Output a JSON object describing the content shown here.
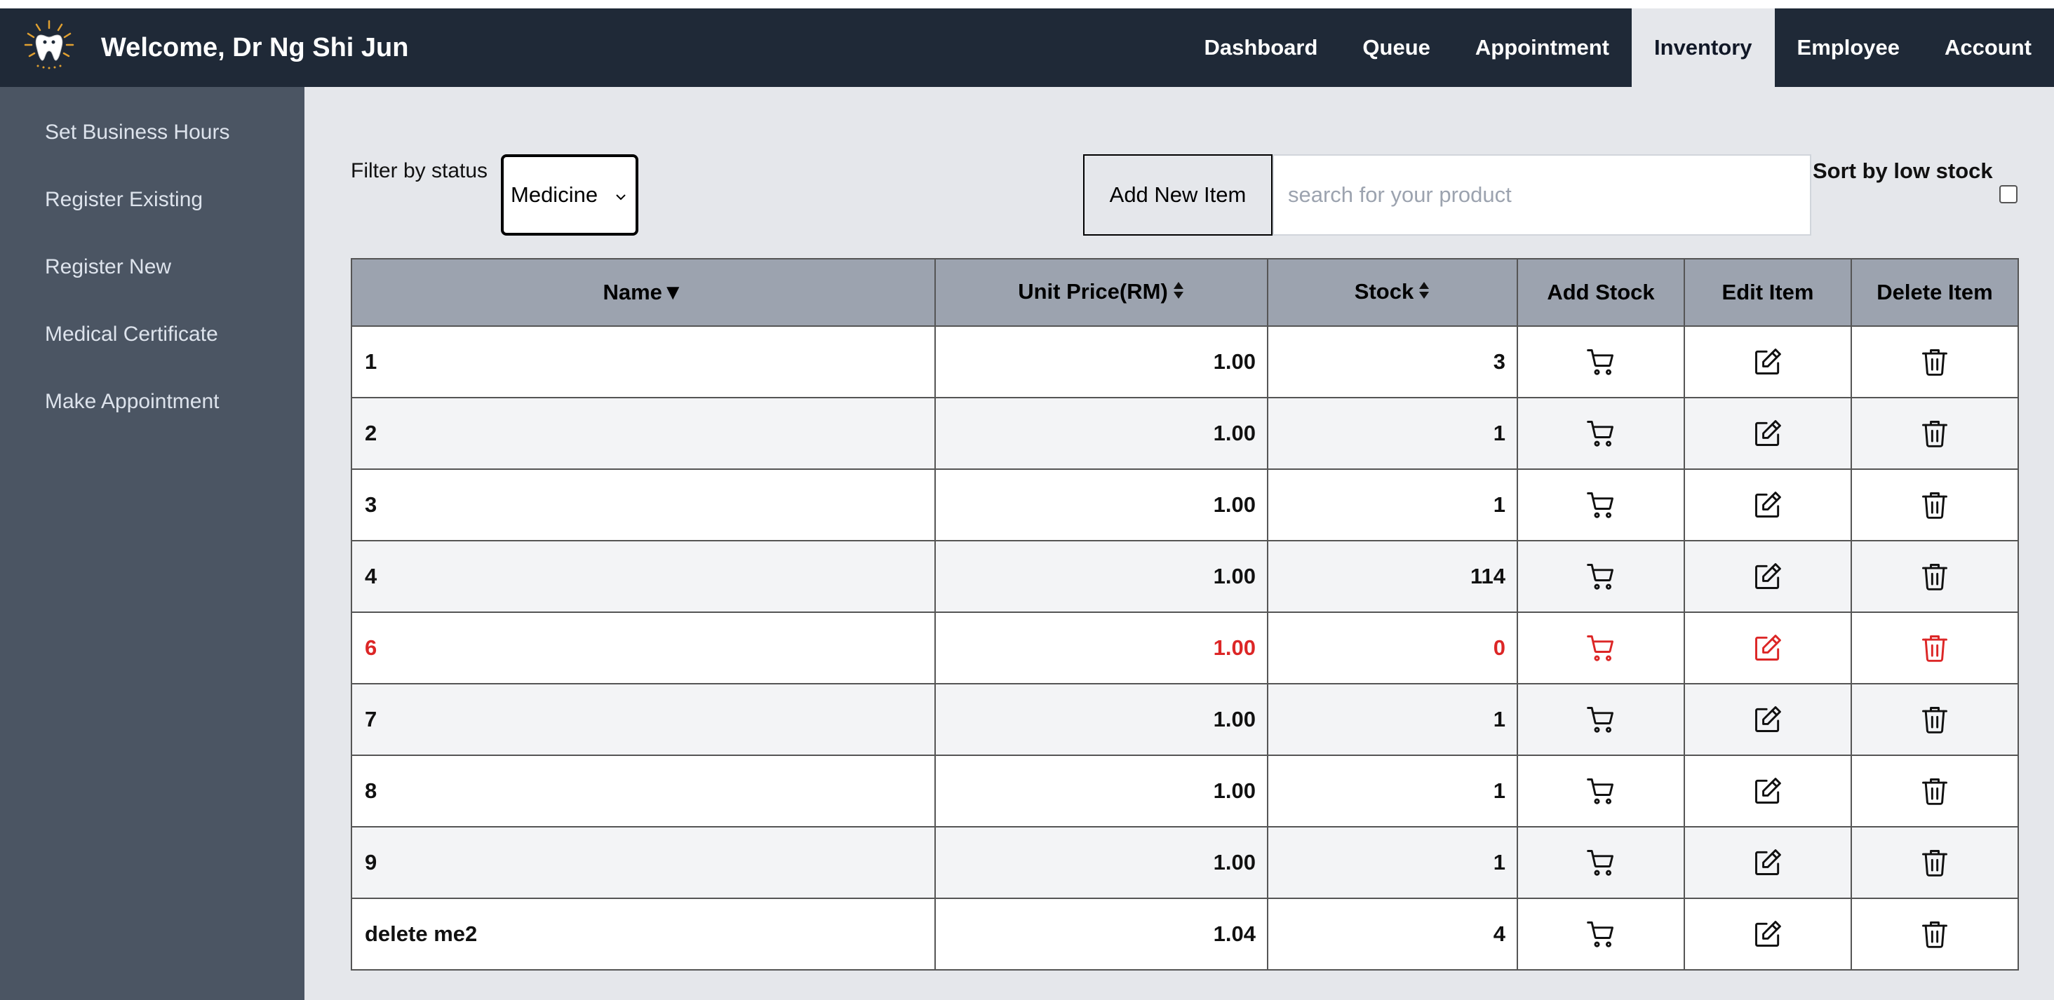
{
  "navbar": {
    "welcome": "Welcome, Dr Ng Shi Jun",
    "links": [
      "Dashboard",
      "Queue",
      "Appointment",
      "Inventory",
      "Employee",
      "Account"
    ],
    "active": "Inventory"
  },
  "sidebar": {
    "items": [
      "Set Business Hours",
      "Register Existing",
      "Register New",
      "Medical Certificate",
      "Make Appointment"
    ]
  },
  "toolbar": {
    "filter_label": "Filter by status",
    "filter_value": "Medicine",
    "add_button": "Add New Item",
    "search_placeholder": "search for your product",
    "search_value": "",
    "sort_label": "Sort by low stock",
    "sort_checked": false
  },
  "table": {
    "headers": [
      "Name",
      "Unit Price(RM)",
      "Stock",
      "Add Stock",
      "Edit Item",
      "Delete Item"
    ],
    "rows": [
      {
        "name": "1",
        "price": "1.00",
        "stock": "3",
        "low": false
      },
      {
        "name": "2",
        "price": "1.00",
        "stock": "1",
        "low": false
      },
      {
        "name": "3",
        "price": "1.00",
        "stock": "1",
        "low": false
      },
      {
        "name": "4",
        "price": "1.00",
        "stock": "114",
        "low": false
      },
      {
        "name": "6",
        "price": "1.00",
        "stock": "0",
        "low": true
      },
      {
        "name": "7",
        "price": "1.00",
        "stock": "1",
        "low": false
      },
      {
        "name": "8",
        "price": "1.00",
        "stock": "1",
        "low": false
      },
      {
        "name": "9",
        "price": "1.00",
        "stock": "1",
        "low": false
      },
      {
        "name": "delete me2",
        "price": "1.04",
        "stock": "4",
        "low": false
      }
    ]
  },
  "colors": {
    "navbar": "#1f2937",
    "sidebar": "#4b5563",
    "main_bg": "#e5e7eb",
    "table_header": "#9ca3af",
    "low_stock": "#dc2626"
  }
}
